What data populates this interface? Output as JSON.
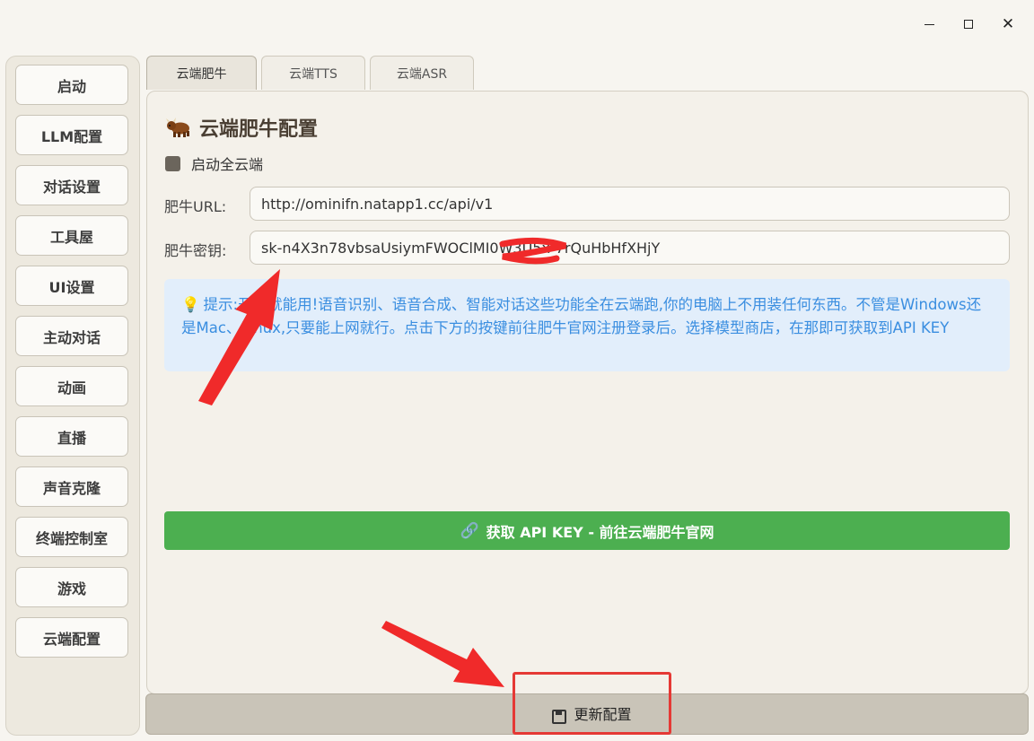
{
  "window": {
    "controls": {
      "minimize": "minimize",
      "maximize": "maximize",
      "close": "✕"
    }
  },
  "sidebar": {
    "items": [
      {
        "label": "启动"
      },
      {
        "label": "LLM配置"
      },
      {
        "label": "对话设置"
      },
      {
        "label": "工具屋"
      },
      {
        "label": "UI设置"
      },
      {
        "label": "主动对话"
      },
      {
        "label": "动画"
      },
      {
        "label": "直播"
      },
      {
        "label": "声音克隆"
      },
      {
        "label": "终端控制室"
      },
      {
        "label": "游戏"
      },
      {
        "label": "云端配置"
      }
    ]
  },
  "tabs": [
    {
      "label": "云端肥牛",
      "active": true
    },
    {
      "label": "云端TTS",
      "active": false
    },
    {
      "label": "云端ASR",
      "active": false
    }
  ],
  "panel": {
    "title": "云端肥牛配置",
    "checkbox_label": "启动全云端",
    "url_label": "肥牛URL:",
    "url_value": "http://ominifn.natapp1.cc/api/v1",
    "key_label": "肥牛密钥:",
    "key_value": "sk-n4X3n78vbsaUsiymFWOClMI0W3U5x-7rQuHbHfXHjY",
    "hint_prefix": "提示:",
    "hint_text": "开箱就能用!语音识别、语音合成、智能对话这些功能全在云端跑,你的电脑上不用装任何东西。不管是Windows还是Mac、Linux,只要能上网就行。点击下方的按键前往肥牛官网注册登录后。选择模型商店，在那即可获取到API KEY",
    "apikey_button": "获取 API KEY - 前往云端肥牛官网"
  },
  "bottom": {
    "update_button": "更新配置"
  },
  "colors": {
    "accent_green": "#4caf50",
    "hint_blue": "#3a8ee0",
    "annotation_red": "#e53935"
  }
}
